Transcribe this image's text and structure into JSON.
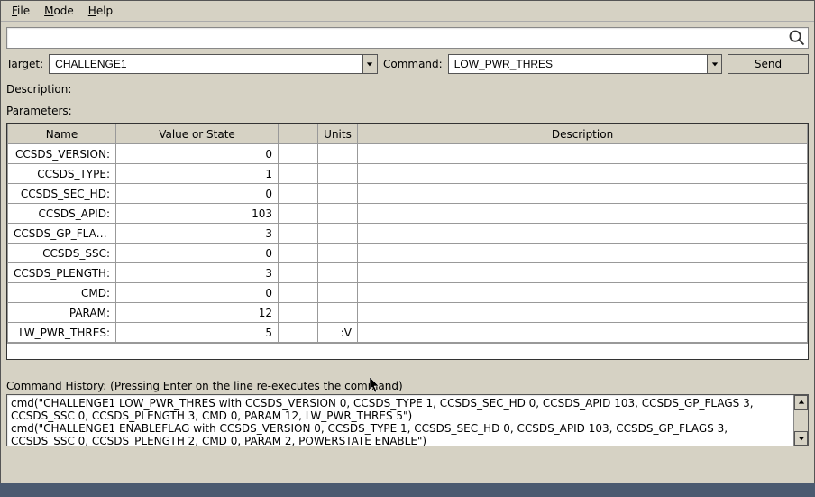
{
  "menu": {
    "file": "File",
    "mode": "Mode",
    "help": "Help"
  },
  "search": {
    "value": ""
  },
  "target": {
    "label": "Target:",
    "value": "CHALLENGE1"
  },
  "command": {
    "label": "Command:",
    "value": "LOW_PWR_THRES"
  },
  "send_label": "Send",
  "description_label": "Description:",
  "parameters_label": "Parameters:",
  "table": {
    "headers": {
      "name": "Name",
      "value": "Value or State",
      "blank": "",
      "units": "Units",
      "desc": "Description"
    },
    "rows": [
      {
        "name": "CCSDS_VERSION:",
        "value": "0",
        "units": "",
        "desc": ""
      },
      {
        "name": "CCSDS_TYPE:",
        "value": "1",
        "units": "",
        "desc": ""
      },
      {
        "name": "CCSDS_SEC_HD:",
        "value": "0",
        "units": "",
        "desc": ""
      },
      {
        "name": "CCSDS_APID:",
        "value": "103",
        "units": "",
        "desc": ""
      },
      {
        "name": "CCSDS_GP_FLAGS:",
        "value": "3",
        "units": "",
        "desc": ""
      },
      {
        "name": "CCSDS_SSC:",
        "value": "0",
        "units": "",
        "desc": ""
      },
      {
        "name": "CCSDS_PLENGTH:",
        "value": "3",
        "units": "",
        "desc": ""
      },
      {
        "name": "CMD:",
        "value": "0",
        "units": "",
        "desc": ""
      },
      {
        "name": "PARAM:",
        "value": "12",
        "units": "",
        "desc": ""
      },
      {
        "name": "LW_PWR_THRES:",
        "value": "5",
        "units": ":V",
        "desc": ""
      }
    ]
  },
  "history_label": "Command History: (Pressing Enter on the line re-executes the command)",
  "history": {
    "line1": "cmd(\"CHALLENGE1 LOW_PWR_THRES with CCSDS_VERSION 0, CCSDS_TYPE 1, CCSDS_SEC_HD 0, CCSDS_APID 103, CCSDS_GP_FLAGS 3, CCSDS_SSC 0, CCSDS_PLENGTH 3, CMD 0, PARAM 12, LW_PWR_THRES 5\")",
    "line2": "cmd(\"CHALLENGE1 ENABLEFLAG with CCSDS_VERSION 0, CCSDS_TYPE 1, CCSDS_SEC_HD 0, CCSDS_APID 103, CCSDS_GP_FLAGS 3, CCSDS_SSC 0, CCSDS_PLENGTH 2, CMD 0, PARAM 2, POWERSTATE ENABLE\")"
  }
}
